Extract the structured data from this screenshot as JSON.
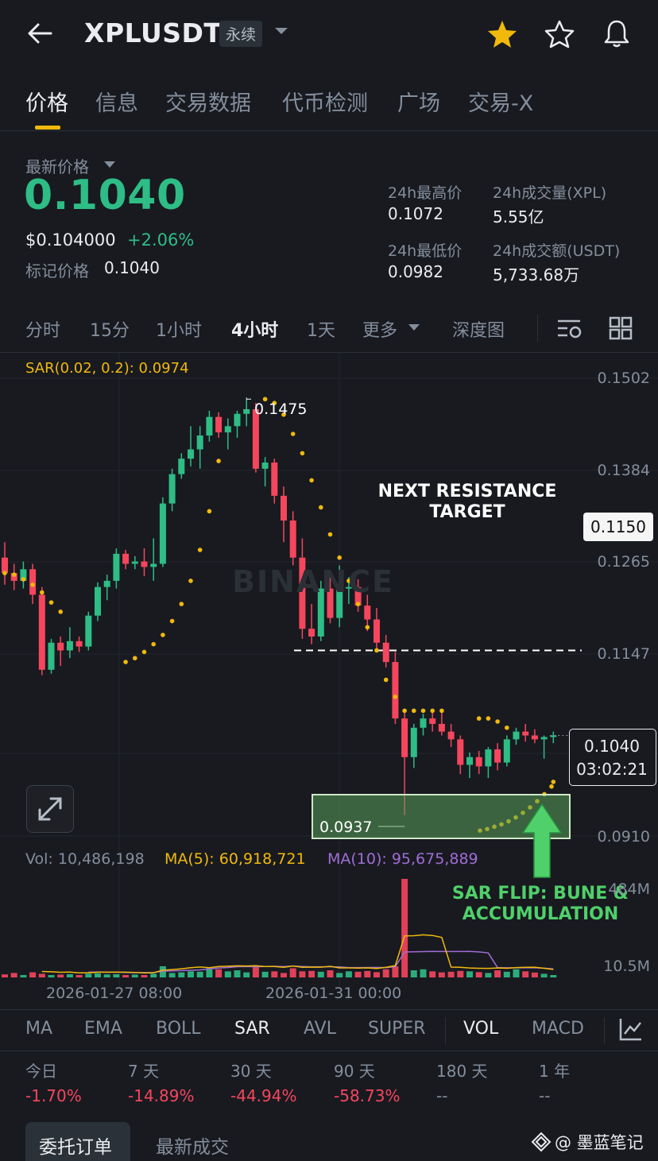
{
  "header": {
    "symbol": "XPLUSDT",
    "contract_type": "永续",
    "icons": [
      "back-arrow-icon",
      "dropdown-caret-icon",
      "star-filled-icon",
      "star-outline-icon",
      "bell-icon"
    ],
    "accent": "#f0b90b"
  },
  "tabs": [
    {
      "label": "价格",
      "active": true
    },
    {
      "label": "信息"
    },
    {
      "label": "交易数据"
    },
    {
      "label": "代币检测"
    },
    {
      "label": "广场"
    },
    {
      "label": "交易-X"
    }
  ],
  "price": {
    "label": "最新价格",
    "last": "0.1040",
    "usd": "$0.104000",
    "change": "+2.06%",
    "mark_label": "标记价格",
    "mark_value": "0.1040"
  },
  "stats": {
    "high_label": "24h最高价",
    "high": "0.1072",
    "vol_label": "24h成交量(XPL)",
    "vol": "5.55亿",
    "low_label": "24h最低价",
    "low": "0.0982",
    "turnover_label": "24h成交额(USDT)",
    "turnover": "5,733.68万"
  },
  "intervals": [
    "分时",
    "15分",
    "1小时",
    "4小时",
    "1天",
    "更多",
    "深度图"
  ],
  "active_interval": "4小时",
  "chart": {
    "sar_label": "SAR(0.02, 0.2): 0.0974",
    "y_axis": [
      "0.1502",
      "0.1384",
      "0.1265",
      "0.1147",
      "0.0910"
    ],
    "high_marker": "0.1475",
    "low_marker": "0.0937",
    "resistance_text_1": "NEXT RESISTANCE",
    "resistance_text_2": "TARGET",
    "resistance_price": "0.1150",
    "current_price": "0.1040",
    "countdown": "03:02:21",
    "watermark": "BINANCE",
    "flip_text_1": "SAR FLIP: BUNE &",
    "flip_text_2": "ACCUMULATION",
    "colors": {
      "up": "#2ebd85",
      "down": "#f6465d",
      "sar": "#f0b90b",
      "ma5": "#f0b90b",
      "ma10": "#a06cd5"
    }
  },
  "volume": {
    "vol": "Vol: 10,486,198",
    "ma5": "MA(5): 60,918,721",
    "ma10": "MA(10): 95,675,889",
    "axis_top": "484M",
    "axis_bottom": "10.5M"
  },
  "dates": [
    "2026-01-27 08:00",
    "2026-01-31 00:00"
  ],
  "indicators": [
    "MA",
    "EMA",
    "BOLL",
    "SAR",
    "AVL",
    "SUPER",
    "VOL",
    "MACD"
  ],
  "performance": [
    {
      "label": "今日",
      "value": "-1.70%"
    },
    {
      "label": "7 天",
      "value": "-14.89%"
    },
    {
      "label": "30 天",
      "value": "-44.94%"
    },
    {
      "label": "90 天",
      "value": "-58.73%"
    },
    {
      "label": "180 天",
      "value": "--"
    },
    {
      "label": "1 年",
      "value": "--"
    }
  ],
  "bottom_tabs": [
    "委托订单",
    "最新成交"
  ],
  "credit": "@ 墨蓝笔记",
  "chart_data": {
    "type": "candlestick",
    "ohlc": [
      [
        0.127,
        0.129,
        0.1235,
        0.125
      ],
      [
        0.125,
        0.1262,
        0.1228,
        0.124
      ],
      [
        0.124,
        0.1265,
        0.123,
        0.1255
      ],
      [
        0.1255,
        0.1262,
        0.121,
        0.1222
      ],
      [
        0.1222,
        0.1232,
        0.1118,
        0.1125
      ],
      [
        0.1125,
        0.1165,
        0.112,
        0.116
      ],
      [
        0.116,
        0.1168,
        0.113,
        0.115
      ],
      [
        0.115,
        0.118,
        0.114,
        0.1162
      ],
      [
        0.1162,
        0.1168,
        0.1148,
        0.1155
      ],
      [
        0.1155,
        0.12,
        0.115,
        0.1195
      ],
      [
        0.1195,
        0.1238,
        0.1188,
        0.1232
      ],
      [
        0.1232,
        0.1248,
        0.1215,
        0.124
      ],
      [
        0.124,
        0.1282,
        0.123,
        0.1275
      ],
      [
        0.1275,
        0.128,
        0.1255,
        0.1262
      ],
      [
        0.1262,
        0.1272,
        0.1255,
        0.1265
      ],
      [
        0.1265,
        0.1282,
        0.1246,
        0.1258
      ],
      [
        0.1258,
        0.1295,
        0.124,
        0.1262
      ],
      [
        0.1262,
        0.1348,
        0.1258,
        0.134
      ],
      [
        0.134,
        0.1385,
        0.133,
        0.1378
      ],
      [
        0.1378,
        0.1405,
        0.1372,
        0.1398
      ],
      [
        0.1398,
        0.144,
        0.1388,
        0.141
      ],
      [
        0.141,
        0.144,
        0.1385,
        0.1428
      ],
      [
        0.1428,
        0.146,
        0.142,
        0.1452
      ],
      [
        0.1452,
        0.1458,
        0.1425,
        0.1432
      ],
      [
        0.1432,
        0.145,
        0.141,
        0.144
      ],
      [
        0.144,
        0.146,
        0.1425,
        0.1456
      ],
      [
        0.1456,
        0.1475,
        0.144,
        0.1462
      ],
      [
        0.1462,
        0.147,
        0.138,
        0.1385
      ],
      [
        0.1385,
        0.14,
        0.1362,
        0.1393
      ],
      [
        0.1393,
        0.1398,
        0.134,
        0.135
      ],
      [
        0.135,
        0.1362,
        0.129,
        0.1318
      ],
      [
        0.1318,
        0.133,
        0.126,
        0.127
      ],
      [
        0.127,
        0.1295,
        0.1165,
        0.1178
      ],
      [
        0.1178,
        0.121,
        0.1158,
        0.1168
      ],
      [
        0.1168,
        0.124,
        0.1162,
        0.123
      ],
      [
        0.123,
        0.1245,
        0.1185,
        0.1192
      ],
      [
        0.1192,
        0.126,
        0.118,
        0.123
      ],
      [
        0.123,
        0.1245,
        0.121,
        0.1232
      ],
      [
        0.1232,
        0.1242,
        0.12,
        0.1208
      ],
      [
        0.1208,
        0.1222,
        0.1175,
        0.119
      ],
      [
        0.119,
        0.1205,
        0.115,
        0.116
      ],
      [
        0.116,
        0.117,
        0.1128,
        0.1135
      ],
      [
        0.1135,
        0.1148,
        0.1055,
        0.1062
      ],
      [
        0.1062,
        0.1072,
        0.0937,
        0.1012
      ],
      [
        0.1012,
        0.1055,
        0.0998,
        0.105
      ],
      [
        0.105,
        0.1068,
        0.104,
        0.1062
      ],
      [
        0.1062,
        0.107,
        0.1045,
        0.1055
      ],
      [
        0.1055,
        0.107,
        0.104,
        0.1045
      ],
      [
        0.1045,
        0.1055,
        0.1025,
        0.1035
      ],
      [
        0.1035,
        0.104,
        0.099,
        0.1002
      ],
      [
        0.1002,
        0.1018,
        0.0985,
        0.1012
      ],
      [
        0.1012,
        0.102,
        0.099,
        0.1
      ],
      [
        0.1,
        0.1025,
        0.0985,
        0.1022
      ],
      [
        0.1022,
        0.103,
        0.0995,
        0.1005
      ],
      [
        0.1005,
        0.104,
        0.1,
        0.1035
      ],
      [
        0.1035,
        0.105,
        0.1028,
        0.1045
      ],
      [
        0.1045,
        0.1055,
        0.1032,
        0.104
      ],
      [
        0.104,
        0.1048,
        0.103,
        0.1035
      ],
      [
        0.1035,
        0.104,
        0.101,
        0.1038
      ],
      [
        0.1038,
        0.1045,
        0.103,
        0.104
      ]
    ],
    "sar": [
      0.125,
      0.1248,
      0.1242,
      0.1235,
      0.1225,
      0.1212,
      0.12,
      null,
      null,
      null,
      null,
      null,
      null,
      0.1135,
      0.114,
      0.1148,
      0.1158,
      0.117,
      0.1188,
      0.121,
      0.124,
      0.128,
      0.133,
      0.1395,
      null,
      null,
      null,
      null,
      0.1475,
      0.147,
      0.1455,
      0.143,
      0.1405,
      0.137,
      0.1335,
      0.13,
      0.127,
      0.124,
      0.121,
      0.118,
      0.115,
      0.1112,
      0.109,
      0.1072,
      0.1072,
      0.1072,
      0.1072,
      0.1072,
      null,
      null,
      null,
      0.1062,
      0.1062,
      0.1058,
      0.105,
      null,
      null,
      null,
      null,
      0.098
    ],
    "sar_flip_points": [
      0.0917,
      0.0919,
      0.0922,
      0.0925,
      0.0929,
      0.0934,
      0.094,
      0.0947,
      0.0955,
      0.0964,
      0.0974
    ],
    "volume_m": [
      15,
      22,
      12,
      25,
      18,
      10,
      14,
      16,
      12,
      18,
      20,
      15,
      16,
      12,
      14,
      12,
      18,
      55,
      22,
      25,
      30,
      28,
      45,
      40,
      30,
      35,
      25,
      50,
      28,
      30,
      22,
      45,
      30,
      32,
      28,
      35,
      22,
      30,
      28,
      32,
      26,
      40,
      55,
      484,
      35,
      40,
      30,
      25,
      28,
      32,
      30,
      26,
      22,
      35,
      28,
      40,
      30,
      24,
      18,
      10
    ],
    "y_range": [
      0.088,
      0.152
    ]
  }
}
